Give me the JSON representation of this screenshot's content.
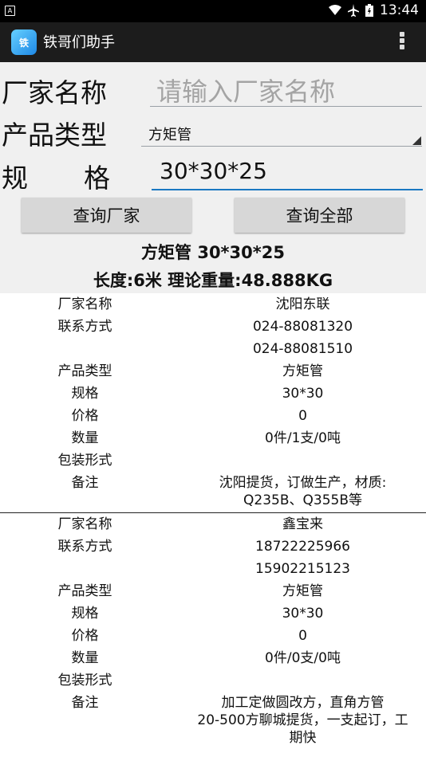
{
  "status_bar": {
    "time": "13:44"
  },
  "app_bar": {
    "title": "铁哥们助手"
  },
  "form": {
    "manufacturer_label": "厂家名称",
    "manufacturer_placeholder": "请输入厂家名称",
    "product_type_label": "产品类型",
    "product_type_value": "方矩管",
    "spec_label_1": "规",
    "spec_label_2": "格",
    "spec_value": "30*30*25"
  },
  "buttons": {
    "query_manufacturer": "查询厂家",
    "query_all": "查询全部"
  },
  "summary": {
    "line1": "方矩管 30*30*25",
    "line2": "长度:6米 理论重量:48.888KG"
  },
  "field_labels": {
    "manufacturer": "厂家名称",
    "contact": "联系方式",
    "product_type": "产品类型",
    "spec": "规格",
    "price": "价格",
    "quantity": "数量",
    "packaging": "包装形式",
    "remarks": "备注"
  },
  "records": [
    {
      "manufacturer": "沈阳东联",
      "phone1": "024-88081320",
      "phone2": "024-88081510",
      "product_type": "方矩管",
      "spec": "30*30",
      "price": "0",
      "quantity": "0件/1支/0吨",
      "packaging": "",
      "remarks_line1": "沈阳提货，订做生产，材质:",
      "remarks_line2": "Q235B、Q355B等"
    },
    {
      "manufacturer": "鑫宝来",
      "phone1": "18722225966",
      "phone2": "15902215123",
      "product_type": "方矩管",
      "spec": "30*30",
      "price": "0",
      "quantity": "0件/0支/0吨",
      "packaging": "",
      "remarks_line1": "加工定做圆改方，直角方管",
      "remarks_line2": "20-500方聊城提货，一支起订，工",
      "remarks_line3": "期快"
    }
  ]
}
